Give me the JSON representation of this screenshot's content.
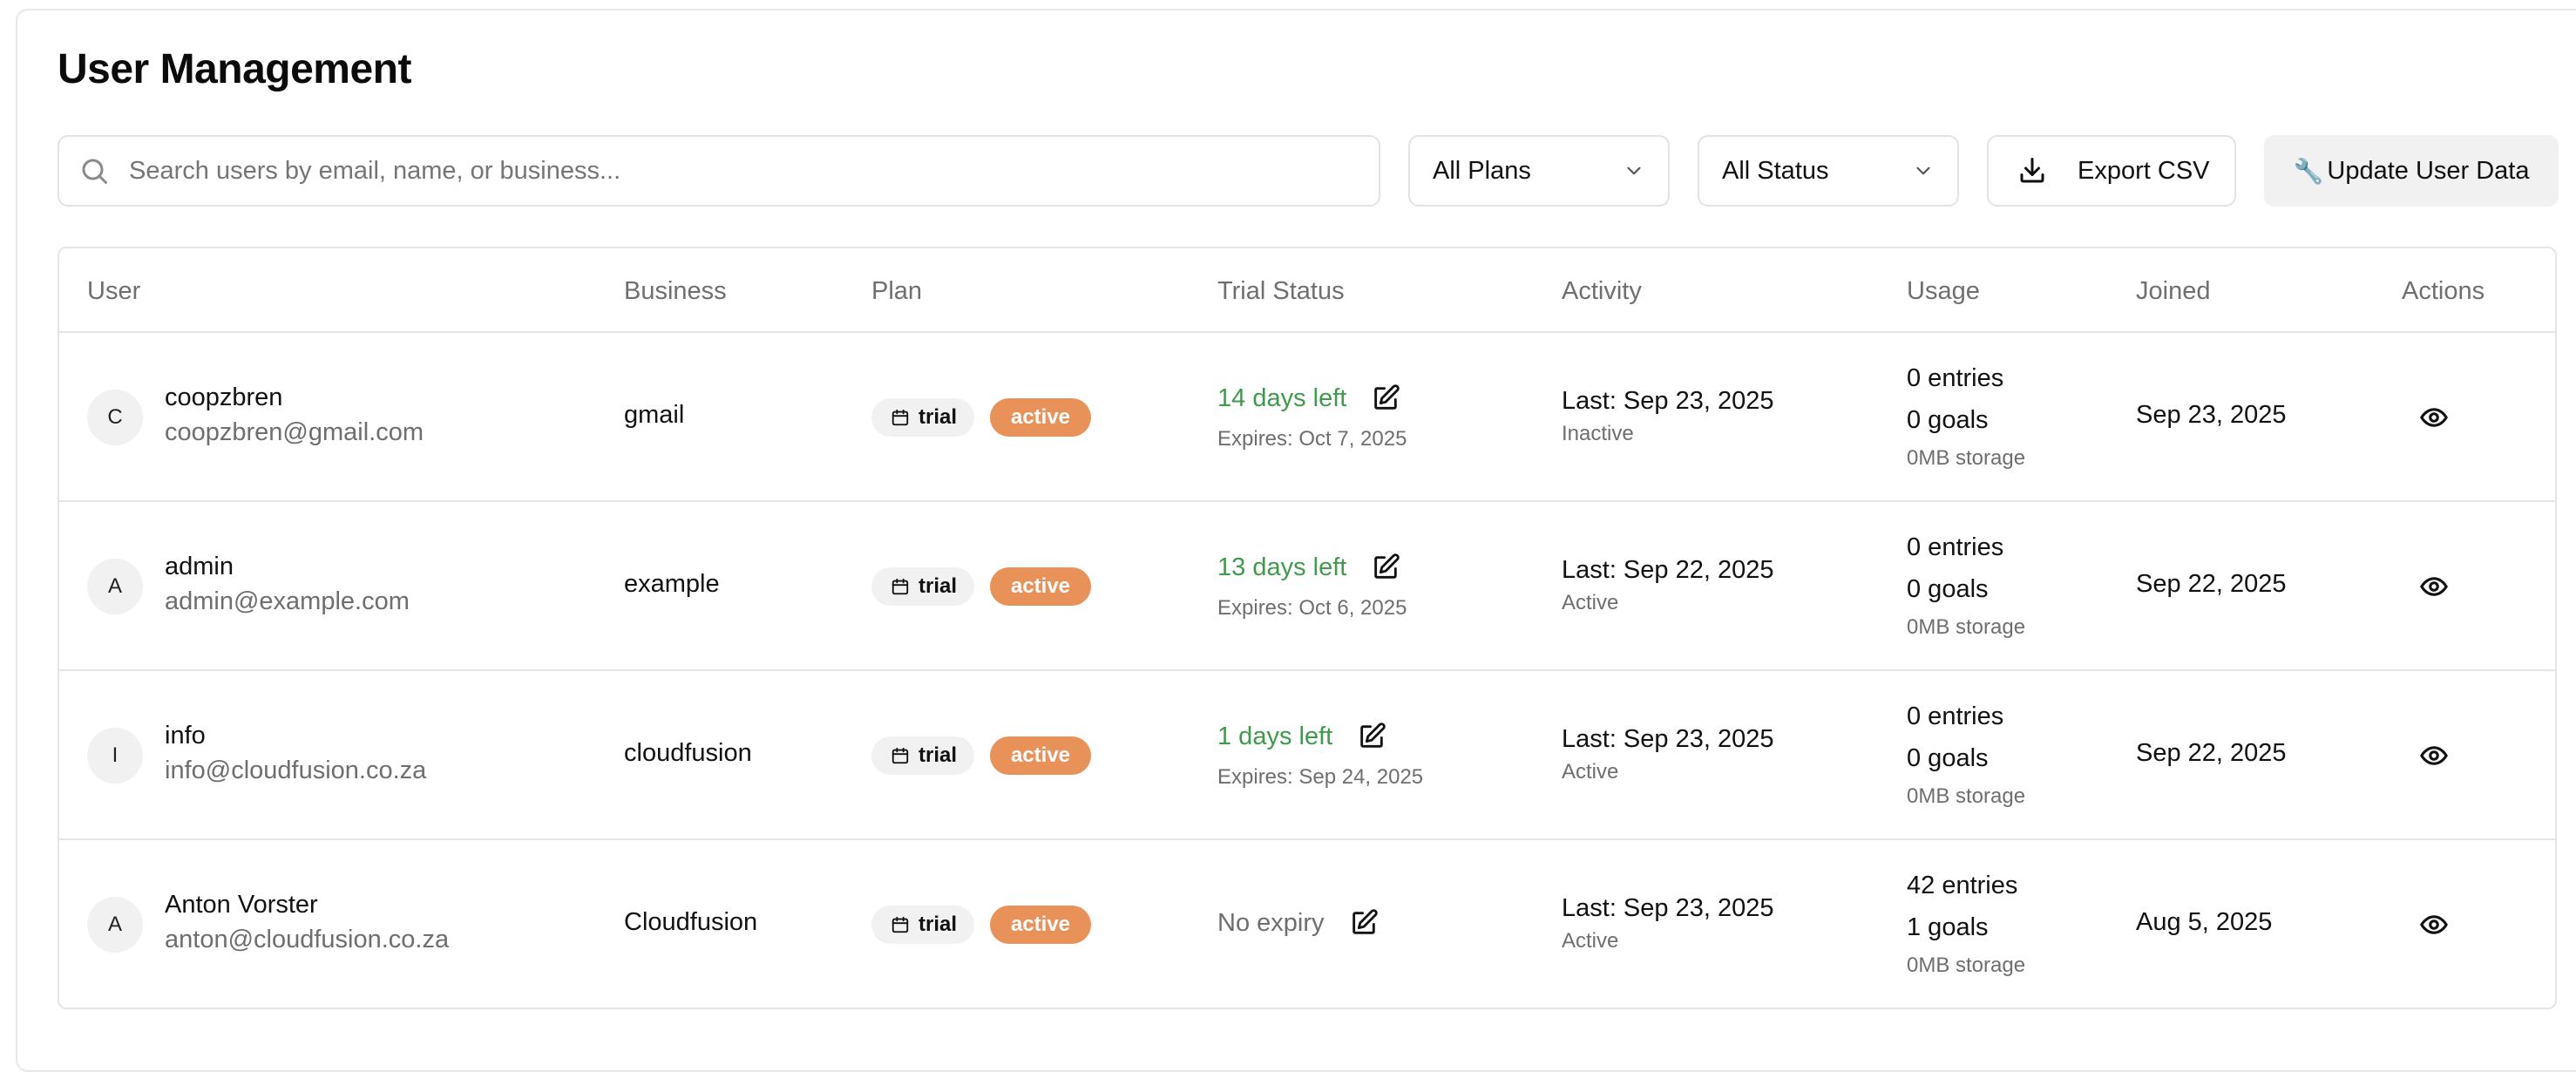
{
  "page": {
    "title": "User Management"
  },
  "toolbar": {
    "search_placeholder": "Search users by email, name, or business...",
    "plans_select": "All Plans",
    "status_select": "All Status",
    "export_label": "Export CSV",
    "update_label": "Update User Data"
  },
  "table": {
    "headers": [
      "User",
      "Business",
      "Plan",
      "Trial Status",
      "Activity",
      "Usage",
      "Joined",
      "Actions"
    ],
    "rows": [
      {
        "initial": "C",
        "name": "coopzbren",
        "email": "coopzbren@gmail.com",
        "business": "gmail",
        "plan": "trial",
        "plan_status": "active",
        "trial_left": "14 days left",
        "trial_expires": "Expires: Oct 7, 2025",
        "activity_last": "Last: Sep 23, 2025",
        "activity_state": "Inactive",
        "entries": "0 entries",
        "goals": "0 goals",
        "storage": "0MB storage",
        "joined": "Sep 23, 2025"
      },
      {
        "initial": "A",
        "name": "admin",
        "email": "admin@example.com",
        "business": "example",
        "plan": "trial",
        "plan_status": "active",
        "trial_left": "13 days left",
        "trial_expires": "Expires: Oct 6, 2025",
        "activity_last": "Last: Sep 22, 2025",
        "activity_state": "Active",
        "entries": "0 entries",
        "goals": "0 goals",
        "storage": "0MB storage",
        "joined": "Sep 22, 2025"
      },
      {
        "initial": "I",
        "name": "info",
        "email": "info@cloudfusion.co.za",
        "business": "cloudfusion",
        "plan": "trial",
        "plan_status": "active",
        "trial_left": "1 days left",
        "trial_expires": "Expires: Sep 24, 2025",
        "activity_last": "Last: Sep 23, 2025",
        "activity_state": "Active",
        "entries": "0 entries",
        "goals": "0 goals",
        "storage": "0MB storage",
        "joined": "Sep 22, 2025"
      },
      {
        "initial": "A",
        "name": "Anton Vorster",
        "email": "anton@cloudfusion.co.za",
        "business": "Cloudfusion",
        "plan": "trial",
        "plan_status": "active",
        "trial_left": "No expiry",
        "trial_expires": "",
        "activity_last": "Last: Sep 23, 2025",
        "activity_state": "Active",
        "entries": "42 entries",
        "goals": "1 goals",
        "storage": "0MB storage",
        "joined": "Aug 5, 2025"
      }
    ]
  },
  "icons": {
    "search": "search-icon",
    "chevron": "chevron-down-icon",
    "download": "download-icon",
    "wrench": "wrench-icon",
    "calendar": "calendar-icon",
    "edit": "edit-icon",
    "view": "eye-icon"
  },
  "colors": {
    "active_badge": "#e8925a",
    "trial_green": "#3f9a4c",
    "muted": "#6e6e6e"
  }
}
